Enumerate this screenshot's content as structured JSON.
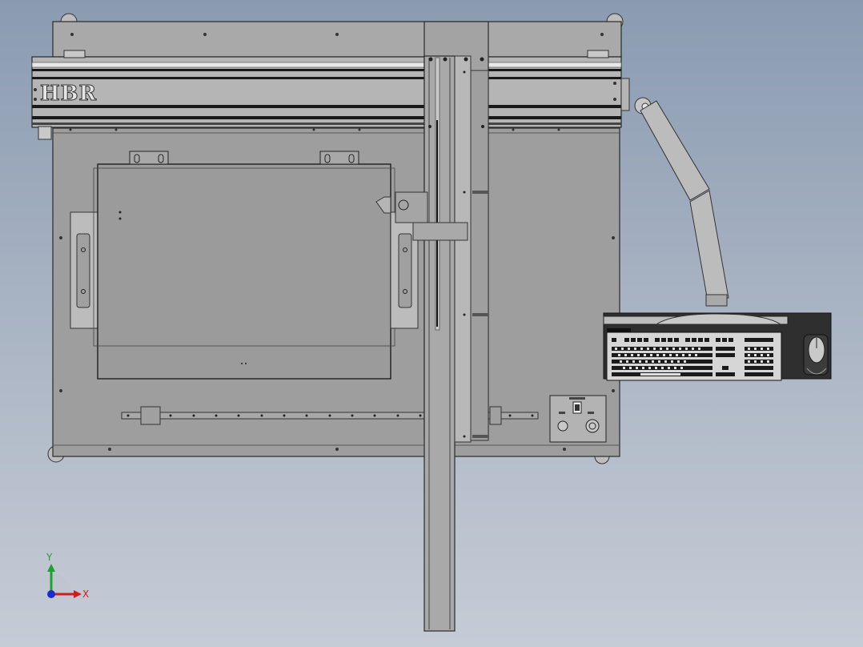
{
  "logo": {
    "text": "HBR"
  },
  "triad": {
    "x_label": "X",
    "y_label": "Y"
  },
  "colors": {
    "frame": "#a6a6a6",
    "plate": "#9c9c9c",
    "outline": "#2a2a2a",
    "rail_dark": "#1a1a1a",
    "arm": "#b9b9b9",
    "x_axis": "#d21c1c",
    "y_axis": "#1fa22c",
    "z_axis": "#1a2bd0"
  },
  "icons": [
    "xyz-triad-icon",
    "keyboard-icon",
    "mouse-icon",
    "toggle-switch-icon",
    "knob-icon",
    "caster-wheel-icon"
  ]
}
